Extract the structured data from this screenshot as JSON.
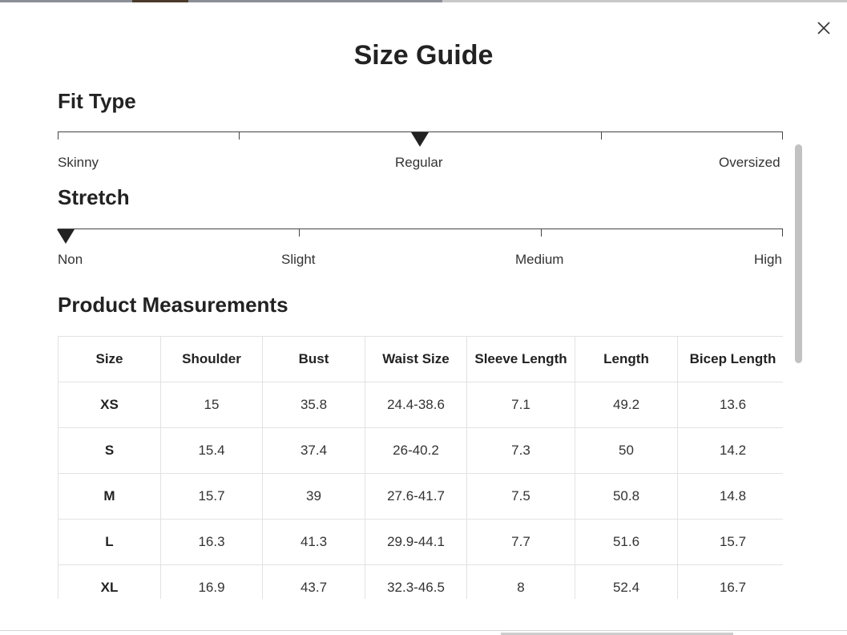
{
  "modal": {
    "title": "Size Guide",
    "close_icon": "close-icon"
  },
  "fit_type": {
    "title": "Fit Type",
    "labels": [
      "Skinny",
      "Regular",
      "Oversized"
    ],
    "selected": "Regular"
  },
  "stretch": {
    "title": "Stretch",
    "labels": [
      "Non",
      "Slight",
      "Medium",
      "High"
    ],
    "selected": "Non"
  },
  "measurements": {
    "title": "Product Measurements",
    "headers": [
      "Size",
      "Shoulder",
      "Bust",
      "Waist Size",
      "Sleeve Length",
      "Length",
      "Bicep Length"
    ],
    "rows": [
      [
        "XS",
        "15",
        "35.8",
        "24.4-38.6",
        "7.1",
        "49.2",
        "13.6"
      ],
      [
        "S",
        "15.4",
        "37.4",
        "26-40.2",
        "7.3",
        "50",
        "14.2"
      ],
      [
        "M",
        "15.7",
        "39",
        "27.6-41.7",
        "7.5",
        "50.8",
        "14.8"
      ],
      [
        "L",
        "16.3",
        "41.3",
        "29.9-44.1",
        "7.7",
        "51.6",
        "15.7"
      ],
      [
        "XL",
        "16.9",
        "43.7",
        "32.3-46.5",
        "8",
        "52.4",
        "16.7"
      ]
    ]
  }
}
